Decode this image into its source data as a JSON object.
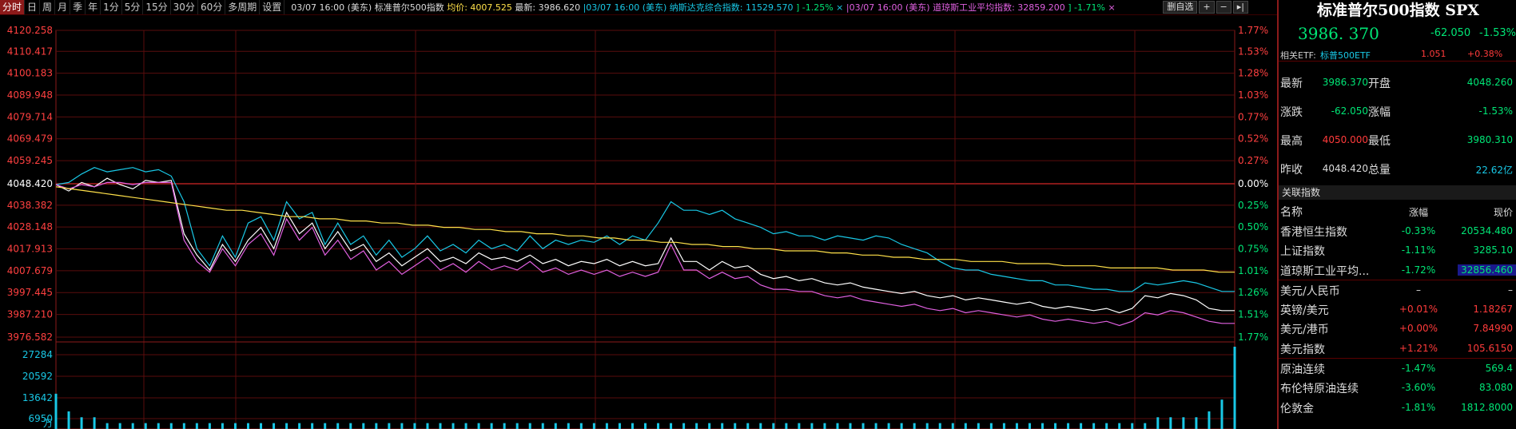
{
  "toolbar": {
    "tabs": [
      "分时",
      "日",
      "周",
      "月",
      "季",
      "年",
      "1分",
      "5分",
      "15分",
      "30分",
      "60分",
      "多周期",
      "设置"
    ],
    "active_tab": "分时",
    "info": [
      {
        "text": "03/07 16:00 (美东) 标准普尔500指数 ",
        "color": "#dddddd"
      },
      {
        "text": "均价: 4007.525 ",
        "color": "#ffe14a"
      },
      {
        "text": "最新: 3986.620 ",
        "color": "#dddddd"
      },
      {
        "text": "|03/07 16:00 (美东) ",
        "color": "#19c8e6"
      },
      {
        "text": "纳斯达克综合指数: 11529.570 ",
        "color": "#19c8e6"
      },
      {
        "text": "] -1.25% ",
        "color": "#00e676"
      },
      {
        "text": "× ",
        "color": "#19c8e6"
      },
      {
        "text": "|03/07 16:00 (美东) ",
        "color": "#e060e0"
      },
      {
        "text": "道琼斯工业平均指数: 32859.200 ",
        "color": "#e060e0"
      },
      {
        "text": "] -1.71% ",
        "color": "#00e676"
      },
      {
        "text": "×",
        "color": "#e060e0"
      }
    ],
    "right_buttons": [
      "删自选",
      "+",
      "−",
      "▸|"
    ]
  },
  "panel": {
    "title": "标准普尔500指数 SPX",
    "price": "3986. 370",
    "change": "-62.050",
    "change_pct": "-1.53%",
    "etf_label": "相关ETF:",
    "etf_name": "标普500ETF",
    "etf_price": "1.051",
    "etf_pct": "+0.38%",
    "stats": [
      {
        "l1": "最新",
        "v1": "3986.370",
        "c1": "green",
        "l2": "开盘",
        "v2": "4048.260",
        "c2": "green"
      },
      {
        "l1": "涨跌",
        "v1": "-62.050",
        "c1": "green",
        "l2": "涨幅",
        "v2": "-1.53%",
        "c2": "green"
      },
      {
        "l1": "最高",
        "v1": "4050.000",
        "c1": "red",
        "l2": "最低",
        "v2": "3980.310",
        "c2": "green"
      },
      {
        "l1": "昨收",
        "v1": "4048.420",
        "c1": "white",
        "l2": "总量",
        "v2": "22.62亿",
        "c2": "cyan"
      }
    ],
    "related_header": "关联指数",
    "cols": {
      "name": "名称",
      "pct": "涨幅",
      "price": "现价"
    },
    "related": [
      {
        "name": "香港恒生指数",
        "pct": "-0.33%",
        "pc": "green",
        "price": "20534.480",
        "prc": "green"
      },
      {
        "name": "上证指数",
        "pct": "-1.11%",
        "pc": "green",
        "price": "3285.10",
        "prc": "green"
      },
      {
        "name": "道琼斯工业平均...",
        "pct": "-1.72%",
        "pc": "green",
        "price": "32856.460",
        "prc": "green",
        "hl": true
      },
      {
        "name": "美元/人民币",
        "pct": "–",
        "pc": "white",
        "price": "–",
        "prc": "white"
      },
      {
        "name": "英镑/美元",
        "pct": "+0.01%",
        "pc": "red",
        "price": "1.18267",
        "prc": "red"
      },
      {
        "name": "美元/港币",
        "pct": "+0.00%",
        "pc": "red",
        "price": "7.84990",
        "prc": "red"
      },
      {
        "name": "美元指数",
        "pct": "+1.21%",
        "pc": "red",
        "price": "105.6150",
        "prc": "red"
      },
      {
        "name": "原油连续",
        "pct": "-1.47%",
        "pc": "green",
        "price": "569.4",
        "prc": "green"
      },
      {
        "name": "布伦特原油连续",
        "pct": "-3.60%",
        "pc": "green",
        "price": "83.080",
        "prc": "green"
      },
      {
        "name": "伦敦金",
        "pct": "-1.81%",
        "pc": "green",
        "price": "1812.8000",
        "prc": "green"
      }
    ]
  },
  "chart_data": {
    "type": "line",
    "prev_close": 4048.42,
    "price_ticks": [
      "4120.258",
      "4110.417",
      "4100.183",
      "4089.948",
      "4079.714",
      "4069.479",
      "4059.245",
      "4048.420",
      "4038.382",
      "4028.148",
      "4017.913",
      "4007.679",
      "3997.445",
      "3987.210",
      "3976.582"
    ],
    "pct_ticks": [
      "1.77%",
      "1.53%",
      "1.28%",
      "1.03%",
      "0.77%",
      "0.52%",
      "0.27%",
      "0.00%",
      "0.25%",
      "0.50%",
      "0.75%",
      "1.01%",
      "1.26%",
      "1.51%",
      "1.77%"
    ],
    "ylim": [
      3976.582,
      4120.258
    ],
    "volume_ticks": [
      "27284",
      "20592",
      "13642",
      "6950",
      "万"
    ],
    "series": [
      {
        "name": "标准普尔500指数",
        "color": "#ffffff",
        "values": [
          4048,
          4045,
          4049,
          4047,
          4051,
          4048,
          4046,
          4050,
          4049,
          4050,
          4025,
          4015,
          4008,
          4020,
          4012,
          4022,
          4028,
          4018,
          4035,
          4025,
          4030,
          4018,
          4026,
          4017,
          4020,
          4012,
          4016,
          4010,
          4014,
          4018,
          4012,
          4014,
          4011,
          4016,
          4013,
          4014,
          4012,
          4015,
          4011,
          4013,
          4010,
          4012,
          4011,
          4013,
          4010,
          4012,
          4010,
          4011,
          4023,
          4012,
          4012,
          4008,
          4012,
          4009,
          4010,
          4006,
          4004,
          4005,
          4003,
          4004,
          4002,
          4001,
          4002,
          4000,
          3999,
          3998,
          3997,
          3998,
          3996,
          3995,
          3996,
          3994,
          3995,
          3994,
          3993,
          3992,
          3993,
          3991,
          3990,
          3991,
          3990,
          3989,
          3990,
          3988,
          3990,
          3996,
          3995,
          3997,
          3996,
          3994,
          3990,
          3989,
          3989
        ]
      },
      {
        "name": "纳斯达克综合指数",
        "color": "#19c8e6",
        "values": [
          4048,
          4049,
          4053,
          4056,
          4054,
          4055,
          4056,
          4054,
          4055,
          4052,
          4040,
          4018,
          4010,
          4024,
          4014,
          4030,
          4033,
          4022,
          4040,
          4032,
          4035,
          4020,
          4030,
          4020,
          4024,
          4015,
          4022,
          4014,
          4018,
          4024,
          4017,
          4020,
          4016,
          4022,
          4018,
          4020,
          4017,
          4024,
          4018,
          4022,
          4020,
          4022,
          4021,
          4024,
          4020,
          4024,
          4022,
          4030,
          4040,
          4036,
          4036,
          4034,
          4036,
          4032,
          4030,
          4028,
          4025,
          4026,
          4024,
          4024,
          4022,
          4024,
          4023,
          4022,
          4024,
          4023,
          4020,
          4018,
          4016,
          4012,
          4009,
          4008,
          4008,
          4006,
          4005,
          4004,
          4003,
          4003,
          4001,
          4001,
          4000,
          3999,
          3999,
          3998,
          3998,
          4002,
          4001,
          4002,
          4003,
          4002,
          4000,
          3998,
          3998
        ]
      },
      {
        "name": "道琼斯工业平均指数",
        "color": "#e060e0",
        "values": [
          4048,
          4046,
          4048,
          4047,
          4049,
          4049,
          4048,
          4049,
          4049,
          4049,
          4022,
          4012,
          4007,
          4018,
          4010,
          4020,
          4025,
          4015,
          4032,
          4022,
          4028,
          4015,
          4022,
          4013,
          4017,
          4008,
          4012,
          4006,
          4010,
          4014,
          4008,
          4011,
          4007,
          4012,
          4008,
          4010,
          4008,
          4012,
          4007,
          4009,
          4006,
          4008,
          4006,
          4008,
          4005,
          4007,
          4005,
          4007,
          4020,
          4008,
          4008,
          4004,
          4007,
          4004,
          4005,
          4001,
          3999,
          3999,
          3998,
          3998,
          3996,
          3995,
          3996,
          3994,
          3993,
          3992,
          3991,
          3992,
          3990,
          3989,
          3990,
          3988,
          3989,
          3988,
          3987,
          3986,
          3987,
          3985,
          3984,
          3985,
          3984,
          3983,
          3984,
          3982,
          3984,
          3988,
          3987,
          3989,
          3988,
          3986,
          3984,
          3983,
          3983
        ]
      },
      {
        "name": "均价",
        "color": "#ffe14a",
        "values": [
          4047,
          4046,
          4045,
          4044,
          4043,
          4042,
          4041,
          4040,
          4039,
          4038,
          4037,
          4036,
          4036,
          4035,
          4034,
          4033,
          4033,
          4032,
          4032,
          4031,
          4031,
          4030,
          4030,
          4029,
          4029,
          4028,
          4028,
          4027,
          4027,
          4026,
          4026,
          4025,
          4025,
          4024,
          4024,
          4023,
          4023,
          4022,
          4022,
          4021,
          4021,
          4020,
          4020,
          4019,
          4019,
          4018,
          4018,
          4017,
          4017,
          4017,
          4016,
          4016,
          4015,
          4015,
          4014,
          4014,
          4013,
          4013,
          4013,
          4012,
          4012,
          4012,
          4011,
          4011,
          4011,
          4010,
          4010,
          4010,
          4009,
          4009,
          4009,
          4009,
          4008,
          4008,
          4008,
          4007,
          4007
        ]
      }
    ],
    "volume": [
      6,
      3,
      2,
      2,
      1,
      1,
      1,
      1,
      1,
      1,
      1,
      1,
      1,
      1,
      1,
      1,
      1,
      1,
      1,
      1,
      1,
      1,
      1,
      1,
      1,
      1,
      1,
      1,
      1,
      1,
      1,
      1,
      1,
      1,
      1,
      1,
      1,
      1,
      1,
      1,
      1,
      1,
      1,
      1,
      1,
      1,
      1,
      1,
      1,
      1,
      1,
      1,
      1,
      1,
      1,
      1,
      1,
      1,
      1,
      1,
      1,
      1,
      1,
      1,
      1,
      1,
      1,
      1,
      1,
      1,
      1,
      1,
      1,
      1,
      1,
      1,
      1,
      1,
      1,
      1,
      1,
      1,
      1,
      1,
      1,
      1,
      2,
      2,
      2,
      2,
      3,
      5,
      14
    ]
  }
}
